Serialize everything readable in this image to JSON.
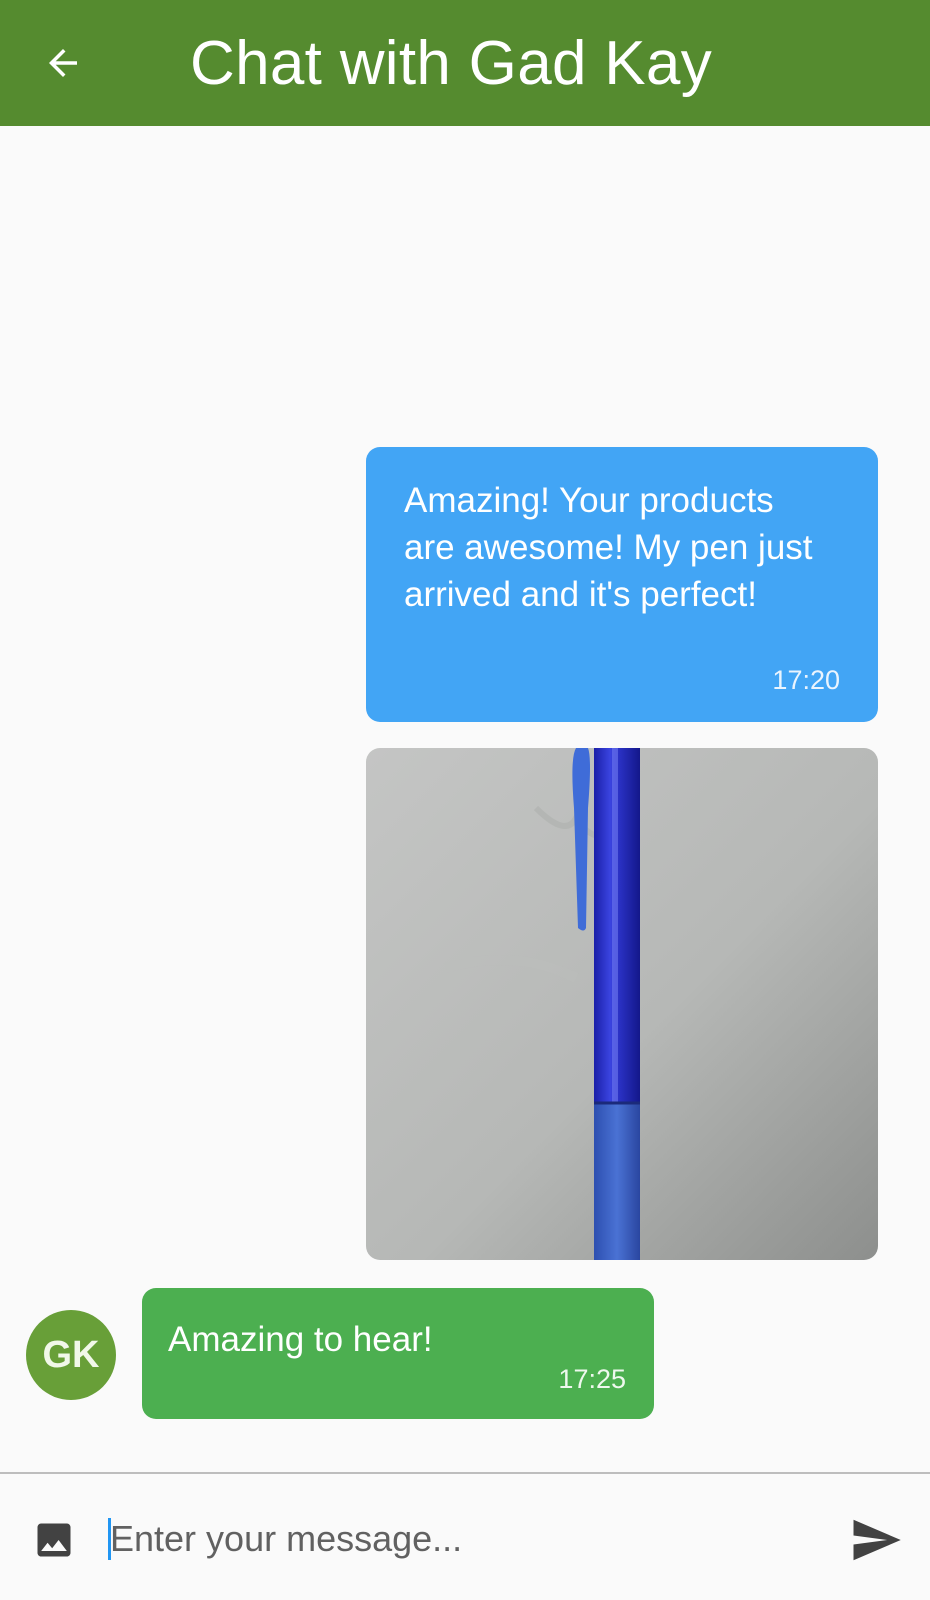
{
  "appbar": {
    "title": "Chat with Gad Kay",
    "back_icon": "arrow-back-icon",
    "background": "#558b2f"
  },
  "messages": [
    {
      "direction": "outgoing",
      "text": "Amazing! Your products are awesome! My pen just arrived and it's perfect!",
      "time": "17:20",
      "color": "#42a5f5"
    },
    {
      "direction": "outgoing",
      "type": "image",
      "image_subject": "blue-pen-photo"
    },
    {
      "direction": "incoming",
      "avatar_initials": "GK",
      "text": "Amazing to hear!",
      "time": "17:25",
      "color": "#4caf50"
    }
  ],
  "composer": {
    "placeholder": "Enter your message...",
    "image_icon": "image-icon",
    "send_icon": "send-icon"
  }
}
